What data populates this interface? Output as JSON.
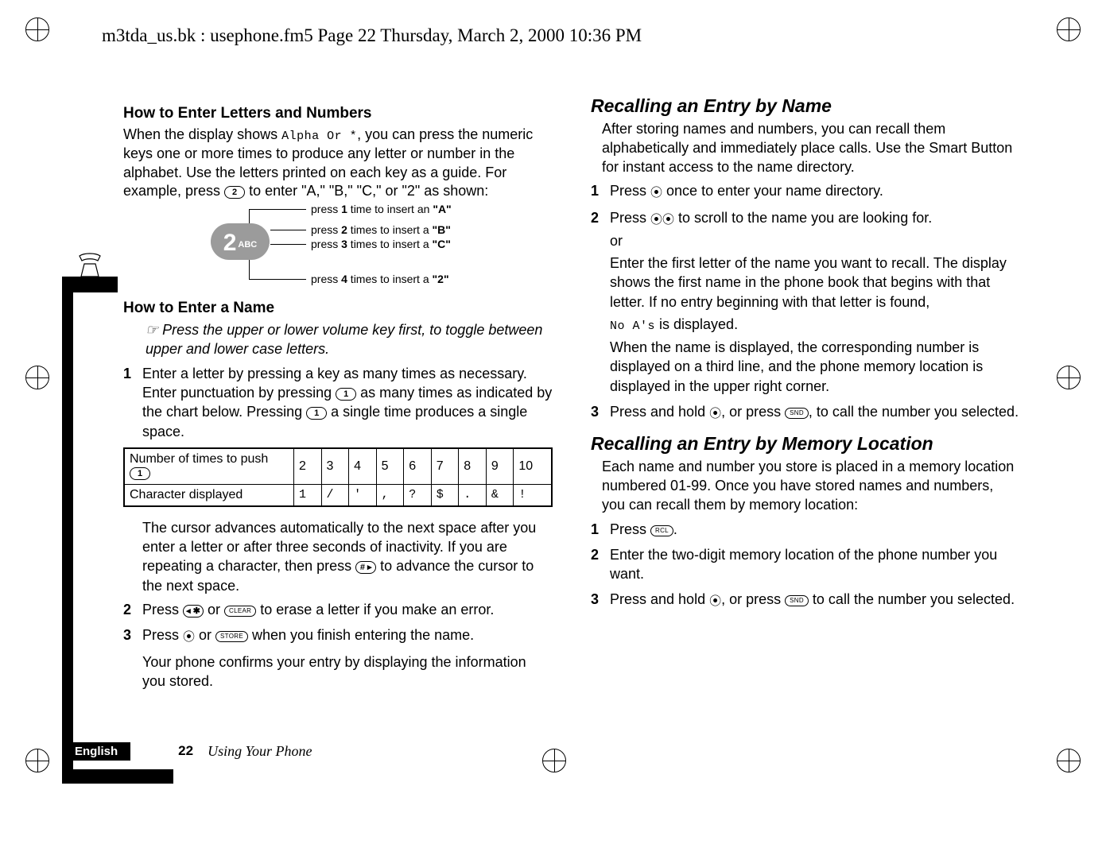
{
  "header_line": "m3tda_us.bk : usephone.fm5  Page 22  Thursday, March 2, 2000  10:36 PM",
  "footer": {
    "language": "English",
    "page_number": "22",
    "section_title": "Using Your Phone"
  },
  "left": {
    "h_enter_letters": "How to Enter Letters and Numbers",
    "p_enter_letters_a": "When the display shows ",
    "p_enter_letters_lcd": "Alpha Or *",
    "p_enter_letters_b": ", you can press the numeric keys one or more times to produce any letter or number in the alphabet. Use the letters printed on each key as a guide. For example, press ",
    "p_enter_letters_c": " to enter \"A,\" \"B,\" \"C,\" or \"2\" as shown:",
    "key_big": "2",
    "key_sub": "ABC",
    "key_lines": {
      "l1a": "press ",
      "l1b": "1",
      "l1c": " time to insert an ",
      "l1q": "\"A\"",
      "l2a": "press ",
      "l2b": "2",
      "l2c": " times to insert a ",
      "l2q": "\"B\"",
      "l3a": "press ",
      "l3b": "3",
      "l3c": " times to insert a ",
      "l3q": "\"C\"",
      "l4a": "press ",
      "l4b": "4",
      "l4c": " times to insert a ",
      "l4q": "\"2\""
    },
    "h_enter_name": "How to Enter a Name",
    "note_enter_name": "Press the upper or lower volume key first, to toggle between upper and lower case letters.",
    "step1_a": "Enter a letter by pressing a key as many times as necessary. Enter punctuation by pressing ",
    "step1_b": " as many times as indicated by the chart below. Pressing ",
    "step1_c": " a single time produces a single space.",
    "table": {
      "row1_label_a": "Number of times to push ",
      "row1": [
        "2",
        "3",
        "4",
        "5",
        "6",
        "7",
        "8",
        "9",
        "10"
      ],
      "row2_label": "Character displayed",
      "row2": [
        "1",
        "/",
        "'",
        ",",
        "?",
        "$",
        ".",
        "&",
        "!"
      ]
    },
    "cursor_a": "The cursor advances automatically to the next space after you enter a letter or after three seconds of inactivity. If you are repeating a character, then press ",
    "cursor_b": " to advance the cursor to the next space.",
    "step2_a": "Press ",
    "step2_b": " or ",
    "step2_c": " to erase a letter if you make an error.",
    "step3_a": "Press ",
    "step3_b": " or ",
    "step3_c": " when you finish entering the name.",
    "confirm": "Your phone confirms your entry by displaying the information you stored.",
    "keys": {
      "one": "1",
      "two": "2",
      "hash": "# ▸",
      "back": "◂ ✱",
      "clear": "CLEAR",
      "store": "STORE",
      "rcl": "RCL",
      "snd": "SND"
    },
    "smart_glyph": "⦿"
  },
  "right": {
    "h_recall_name": "Recalling an Entry by Name",
    "p_recall_name": "After storing names and numbers, you can recall them alphabetically and immediately place calls. Use the Smart Button for instant access to the name directory.",
    "s1": " once to enter your name directory.",
    "s2": " to scroll to the name you are looking for.",
    "or": "or",
    "s2b": "Enter the first letter of the name you want to recall. The display shows the first name in the phone book that begins with that letter. If no entry beginning with that letter is found,",
    "s2c_lcd": "No A's",
    "s2c_after": " is displayed.",
    "s2d": "When the name is displayed, the corresponding number is displayed on a third line, and the phone memory location is displayed in the upper right corner.",
    "s3a": "Press and hold ",
    "s3b": ", or press ",
    "s3c": ", to call the number you selected.",
    "h_recall_loc": "Recalling an Entry by Memory Location",
    "p_recall_loc": "Each name and number you store is placed in a memory location numbered 01-99. Once you have stored names and numbers, you can recall them by memory location:",
    "l1_a": "Press ",
    "l1_b": ".",
    "l2": "Enter the two-digit memory location of the phone number you want.",
    "l3_a": "Press and hold ",
    "l3_b": ", or press ",
    "l3_c": " to call the number you selected."
  }
}
